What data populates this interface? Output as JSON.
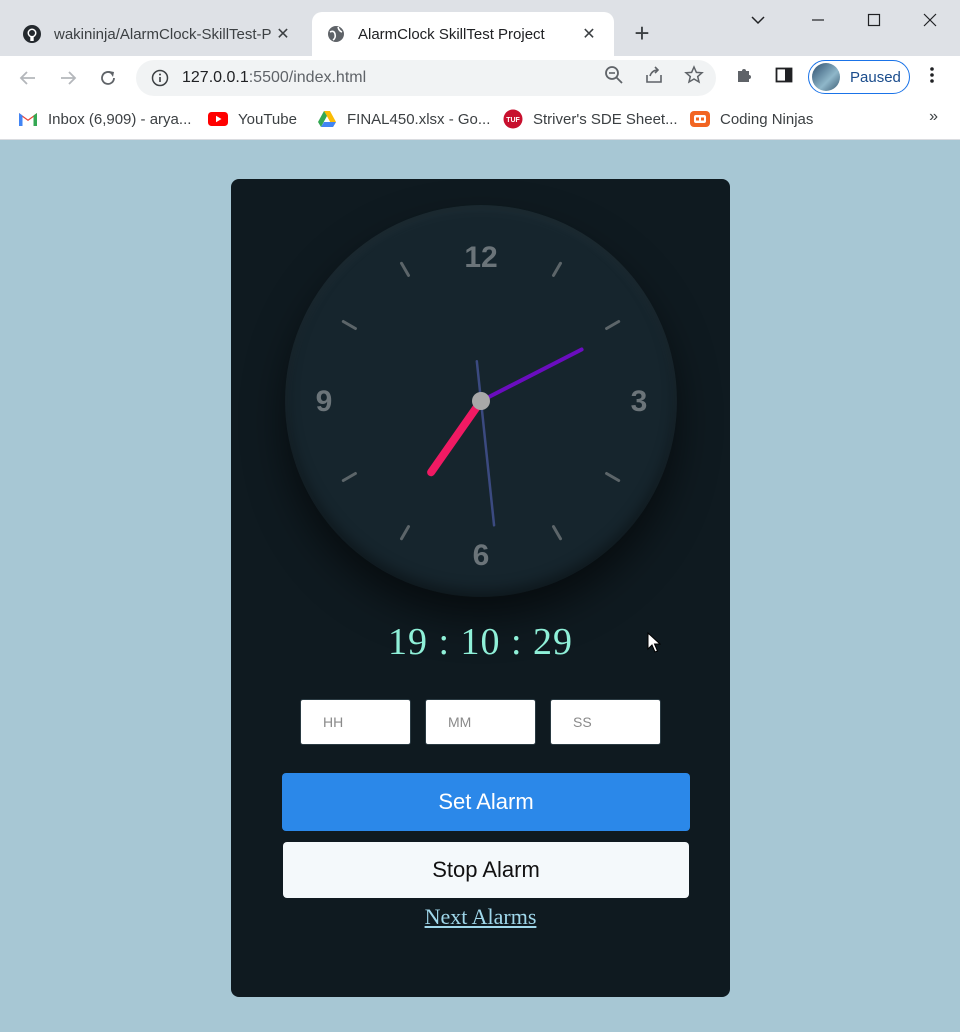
{
  "browser": {
    "tabs": [
      {
        "title": "wakininja/AlarmClock-SkillTest-Project",
        "active": false,
        "icon": "github-icon"
      },
      {
        "title": "AlarmClock SkillTest Project",
        "active": true,
        "icon": "globe-icon"
      }
    ],
    "address": {
      "host": "127.0.0.1",
      "rest": ":5500/index.html"
    },
    "profile_label": "Paused",
    "bookmarks": [
      {
        "label": "Inbox (6,909) - arya...",
        "icon": "gmail-icon"
      },
      {
        "label": "YouTube",
        "icon": "youtube-icon"
      },
      {
        "label": "FINAL450.xlsx - Go...",
        "icon": "drive-icon"
      },
      {
        "label": "Striver's SDE Sheet...",
        "icon": "tuf-icon"
      },
      {
        "label": "Coding Ninjas",
        "icon": "coding-ninjas-icon"
      }
    ],
    "bookmarks_more": "»"
  },
  "clock": {
    "numerals": {
      "twelve": "12",
      "three": "3",
      "six": "6",
      "nine": "9"
    },
    "time": {
      "hours": 19,
      "minutes": 10,
      "seconds": 29
    },
    "colors": {
      "hour_hand": "#f01a63",
      "minute_hand": "#6a0dbf",
      "second_hand": "#3b4a80",
      "center": "#a8a8a8"
    }
  },
  "digital_time": "19 : 10 : 29",
  "alarm_inputs": {
    "hours_placeholder": "HH",
    "minutes_placeholder": "MM",
    "seconds_placeholder": "SS"
  },
  "buttons": {
    "set_alarm": "Set Alarm",
    "stop_alarm": "Stop Alarm"
  },
  "next_alarms_link": "Next Alarms",
  "colors": {
    "page_bg": "#a7c7d4",
    "card_bg": "#0f1a20",
    "accent_blue": "#2b88e9",
    "digital_text": "#8ff0d8",
    "link": "#9fd7ea"
  }
}
